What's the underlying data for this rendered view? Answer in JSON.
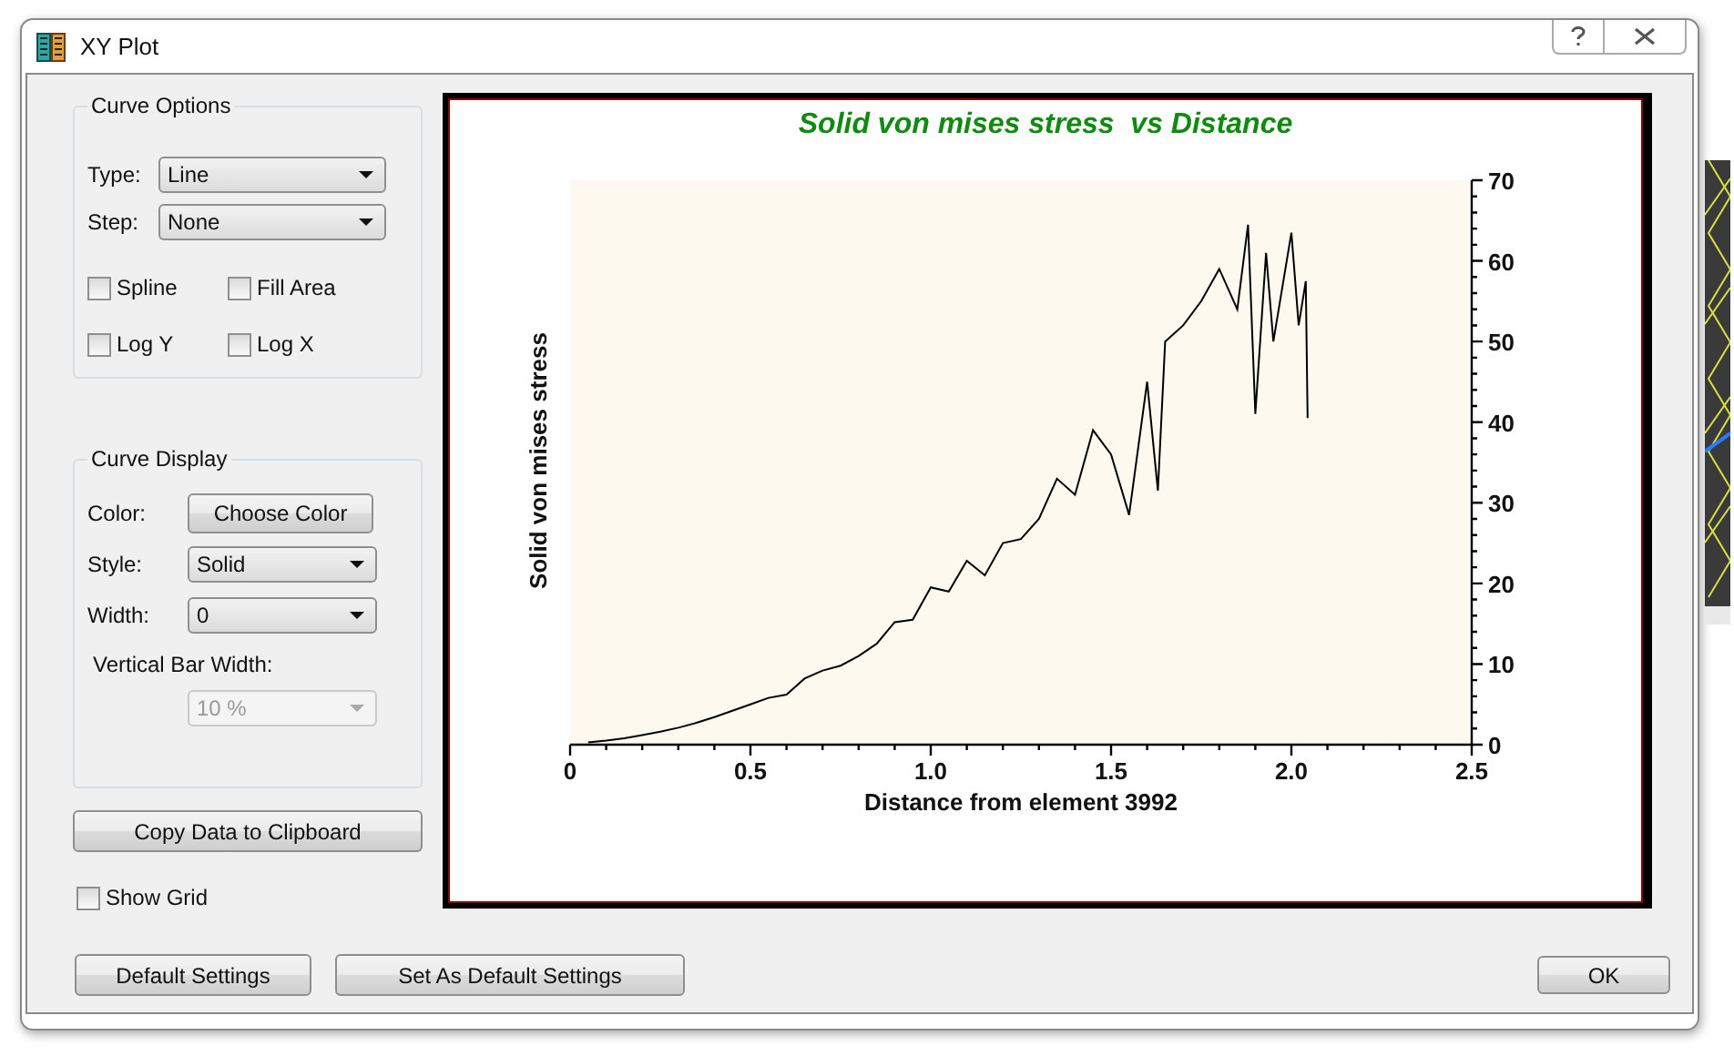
{
  "window": {
    "title": "XY Plot"
  },
  "curve_options": {
    "title": "Curve Options",
    "fields": [
      {
        "label": "Type:",
        "value": "Line"
      },
      {
        "label": "Step:",
        "value": "None"
      }
    ],
    "checkboxes": [
      {
        "label": "Spline",
        "checked": false
      },
      {
        "label": "Fill Area",
        "checked": false
      },
      {
        "label": "Log Y",
        "checked": false
      },
      {
        "label": "Log X",
        "checked": false
      }
    ]
  },
  "curve_display": {
    "title": "Curve Display",
    "color_label": "Color:",
    "color_button": "Choose Color",
    "fields": [
      {
        "label": "Style:",
        "value": "Solid"
      },
      {
        "label": "Width:",
        "value": "0"
      }
    ],
    "bar_width": {
      "label": "Vertical Bar Width:",
      "value": "10 %",
      "disabled": true
    }
  },
  "copy_button": "Copy Data to Clipboard",
  "show_grid": {
    "label": "Show Grid",
    "checked": false
  },
  "buttons": [
    "Default Settings",
    "Set As Default Settings"
  ],
  "ok_button": "OK",
  "chart": {
    "chart_data": {
      "type": "line",
      "title": "Solid von mises stress  vs Distance",
      "xlabel": "Distance from element 3992",
      "ylabel": "Solid von mises stress",
      "x": [
        0.05,
        0.1,
        0.15,
        0.2,
        0.25,
        0.3,
        0.35,
        0.4,
        0.45,
        0.5,
        0.55,
        0.6,
        0.65,
        0.7,
        0.75,
        0.8,
        0.85,
        0.9,
        0.95,
        1.0,
        1.05,
        1.1,
        1.15,
        1.2,
        1.25,
        1.3,
        1.35,
        1.4,
        1.45,
        1.5,
        1.55,
        1.6,
        1.63,
        1.65,
        1.7,
        1.75,
        1.8,
        1.85,
        1.88,
        1.9,
        1.93,
        1.95,
        2.0,
        2.02,
        2.04,
        2.045
      ],
      "series": [
        {
          "color": "#000000",
          "values": [
            0.3,
            0.5,
            0.8,
            1.2,
            1.6,
            2.1,
            2.7,
            3.4,
            4.2,
            5,
            5.8,
            6.2,
            8.2,
            9.2,
            9.8,
            11,
            12.5,
            15.2,
            15.5,
            19.5,
            19,
            22.8,
            21,
            25,
            25.5,
            28,
            33,
            31,
            39,
            36,
            28.5,
            45,
            31.5,
            50,
            52,
            55,
            59,
            54,
            64.5,
            41,
            61,
            50,
            63.5,
            52,
            57.5,
            40.5
          ]
        }
      ],
      "xlim": [
        0,
        2.5
      ],
      "ylim": [
        0,
        70
      ],
      "xticks": [
        {
          "value": 0,
          "label": "0"
        },
        {
          "value": 0.5,
          "label": "0.5"
        },
        {
          "value": 1,
          "label": "1.0"
        },
        {
          "value": 1.5,
          "label": "1.5"
        },
        {
          "value": 2,
          "label": "2.0"
        },
        {
          "value": 2.5,
          "label": "2.5"
        }
      ],
      "yticks": [
        0,
        10,
        20,
        30,
        40,
        50,
        60,
        70
      ]
    }
  }
}
